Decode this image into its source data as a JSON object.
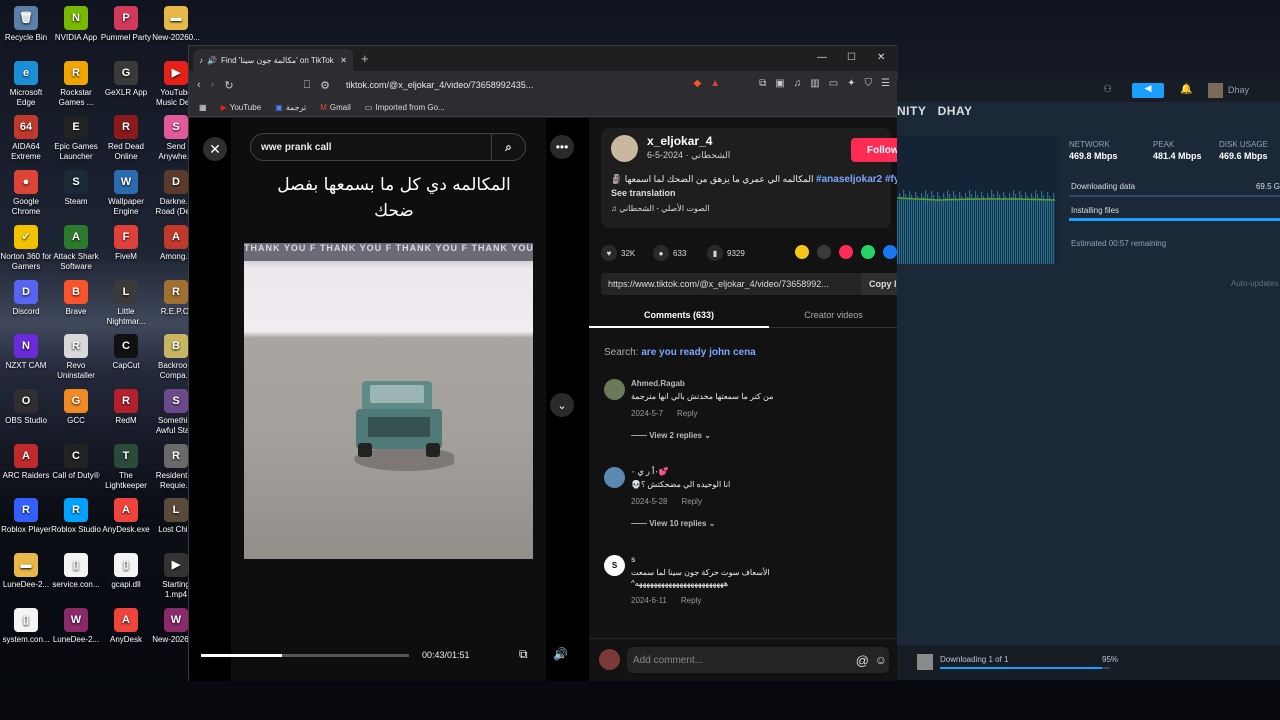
{
  "desktop": {
    "icons": [
      {
        "label": "Recycle Bin",
        "color": "#5a7fa8",
        "glyph": "🗑"
      },
      {
        "label": "NVIDIA App",
        "color": "#76b900",
        "glyph": "N"
      },
      {
        "label": "Pummel Party",
        "color": "#d23a5a",
        "glyph": "P"
      },
      {
        "label": "New-20260...",
        "color": "#e8b84a",
        "glyph": "▬"
      },
      {
        "label": "Microsoft Edge",
        "color": "#1a8fd6",
        "glyph": "e"
      },
      {
        "label": "Rockstar Games ...",
        "color": "#f0a500",
        "glyph": "R"
      },
      {
        "label": "GeXLR App",
        "color": "#3a3a3a",
        "glyph": "G"
      },
      {
        "label": "YouTube Music De...",
        "color": "#e62117",
        "glyph": "▶"
      },
      {
        "label": "AIDA64 Extreme",
        "color": "#c0392b",
        "glyph": "64"
      },
      {
        "label": "Epic Games Launcher",
        "color": "#222222",
        "glyph": "E"
      },
      {
        "label": "Red Dead Online",
        "color": "#8b1a1a",
        "glyph": "R"
      },
      {
        "label": "Send Anywhe...",
        "color": "#e05a9c",
        "glyph": "S"
      },
      {
        "label": "Google Chrome",
        "color": "#db4437",
        "glyph": "●"
      },
      {
        "label": "Steam",
        "color": "#1b2838",
        "glyph": "S"
      },
      {
        "label": "Wallpaper Engine",
        "color": "#2b6cb0",
        "glyph": "W"
      },
      {
        "label": "Darkne... Road (De...",
        "color": "#5a3a2a",
        "glyph": "D"
      },
      {
        "label": "Norton 360 for Gamers",
        "color": "#f2c200",
        "glyph": "✓"
      },
      {
        "label": "Attack Shark Software",
        "color": "#2c7a2c",
        "glyph": "A"
      },
      {
        "label": "FiveM",
        "color": "#e0403a",
        "glyph": "F"
      },
      {
        "label": "Among...",
        "color": "#c0392b",
        "glyph": "A"
      },
      {
        "label": "Discord",
        "color": "#5865f2",
        "glyph": "D"
      },
      {
        "label": "Brave",
        "color": "#fb542b",
        "glyph": "B"
      },
      {
        "label": "Little Nightmar...",
        "color": "#3a3a3a",
        "glyph": "L"
      },
      {
        "label": "R.E.P.O.",
        "color": "#a07030",
        "glyph": "R"
      },
      {
        "label": "NZXT CAM",
        "color": "#6a2bd9",
        "glyph": "N"
      },
      {
        "label": "Revo Uninstaller",
        "color": "#d9d9d9",
        "glyph": "R"
      },
      {
        "label": "CapCut",
        "color": "#111111",
        "glyph": "C"
      },
      {
        "label": "Backroo... Compa...",
        "color": "#c8b560",
        "glyph": "B"
      },
      {
        "label": "OBS Studio",
        "color": "#302e31",
        "glyph": "O"
      },
      {
        "label": "GCC",
        "color": "#f08a24",
        "glyph": "G"
      },
      {
        "label": "RedM",
        "color": "#b3202a",
        "glyph": "R"
      },
      {
        "label": "Somethi... Awful Sta...",
        "color": "#6a4a8a",
        "glyph": "S"
      },
      {
        "label": "ARC Raiders",
        "color": "#c02a2a",
        "glyph": "A"
      },
      {
        "label": "Call of Duty®",
        "color": "#222222",
        "glyph": "C"
      },
      {
        "label": "The Lightkeeper",
        "color": "#2a4a3a",
        "glyph": "T"
      },
      {
        "label": "Resident ... Requie...",
        "color": "#6a6a6a",
        "glyph": "R"
      },
      {
        "label": "Roblox Player",
        "color": "#335fff",
        "glyph": "R"
      },
      {
        "label": "Roblox Studio",
        "color": "#00a2ff",
        "glyph": "R"
      },
      {
        "label": "AnyDesk.exe",
        "color": "#ef443b",
        "glyph": "A"
      },
      {
        "label": "Lost Child",
        "color": "#5a4a3a",
        "glyph": "L"
      },
      {
        "label": "LuneDee-2...",
        "color": "#e8b84a",
        "glyph": "▬"
      },
      {
        "label": "service.con...",
        "color": "#f4f4f4",
        "glyph": "▯"
      },
      {
        "label": "gcapi.dll",
        "color": "#f4f4f4",
        "glyph": "▯"
      },
      {
        "label": "Starting 1.mp4",
        "color": "#333333",
        "glyph": "▶"
      },
      {
        "label": "system.con...",
        "color": "#f4f4f4",
        "glyph": "▯"
      },
      {
        "label": "LuneDee-2...",
        "color": "#8a2a6a",
        "glyph": "W"
      },
      {
        "label": "AnyDesk",
        "color": "#ef443b",
        "glyph": "A"
      },
      {
        "label": "New-20260...",
        "color": "#8a2a6a",
        "glyph": "W"
      }
    ]
  },
  "browser": {
    "tab_title": "Find 'مكالمة جون سينا' on TikTok",
    "new_tab": "+",
    "url": "tiktok.com/@x_eljokar_4/video/73658992435...",
    "bookmarks": [
      {
        "label": "YouTube",
        "icon": "youtube-icon"
      },
      {
        "label": "ترجمة",
        "icon": "translate-icon"
      },
      {
        "label": "Gmail",
        "icon": "gmail-icon"
      },
      {
        "label": "Imported from Go...",
        "icon": "folder-icon"
      }
    ],
    "window_controls": {
      "minimize": "—",
      "maximize": "☐",
      "close": "✕"
    }
  },
  "video": {
    "search_value": "wwe prank call",
    "caption": "المكالمه دي كل ما بسمعها بفصل ضحك",
    "banner_text": "THANK YOU F THANK YOU F THANK YOU F THANK YOU",
    "time": "00:43/01:51",
    "progress": 0.39
  },
  "post": {
    "username": "x_eljokar_4",
    "nickname": "الشحطاني",
    "date": "2024-5-6",
    "follow_label": "Follow",
    "description": "المكالمه الي عمري ما يزهق من الضحك لما اسمعها 🗿",
    "hashtags": "#anaseljokar2 #fyp",
    "see_translation": "See translation",
    "sound": "الصوت الأصلي - الشحطاني",
    "likes": "32K",
    "comments": "633",
    "saves": "9329",
    "link": "https://www.tiktok.com/@x_eljokar_4/video/73658992...",
    "copy_label": "Copy link",
    "share_colors": [
      "#f5c518",
      "#3a3a3a",
      "#fe2c55",
      "#25d366",
      "#1877f2"
    ]
  },
  "comments_section": {
    "tab_comments": "Comments (633)",
    "tab_creator": "Creator videos",
    "search_prefix": "Search:",
    "search_term": "are you ready john cena",
    "items": [
      {
        "name": "Ahmed.Ragab",
        "text": "من كتر ما سمعتها مخدتش بالي انها مترجمة",
        "date": "2024-5-7",
        "reply": "Reply",
        "replies": "View 2 replies",
        "avatar": "#6a7a5a"
      },
      {
        "name": "٠أ ر ي ٠💕",
        "text": "انا الوحيده الي مضحكتش ؟💀",
        "date": "2024-5-28",
        "reply": "Reply",
        "replies": "View 10 replies",
        "avatar": "#5a8ab0"
      },
      {
        "name": "s",
        "text": "الأسعاف سوت حركة جون سينا لما سمعت",
        "text2": "^ههههههههههههههههههههههههه",
        "date": "2024-6-11",
        "reply": "Reply",
        "replies": "",
        "avatar": "#ffffff"
      }
    ],
    "add_placeholder": "Add comment..."
  },
  "steam": {
    "nav": "NITY   DHAY",
    "user": "Dhay",
    "network_label": "NETWORK",
    "network_value": "469.8 Mbps",
    "peak_label": "PEAK",
    "peak_value": "481.4 Mbps",
    "disk_label": "DISK USAGE",
    "disk_value": "469.6 Mbps",
    "downloading_label": "Downloading data",
    "downloading_value": "69.5 G",
    "installing_label": "Installing files",
    "eta": "Estimated 00:57 remaining",
    "auto_updates": "Auto-updates",
    "bottom_status": "Downloading 1 of 1",
    "bottom_pct": "95%",
    "bottom_progress": 0.95
  }
}
